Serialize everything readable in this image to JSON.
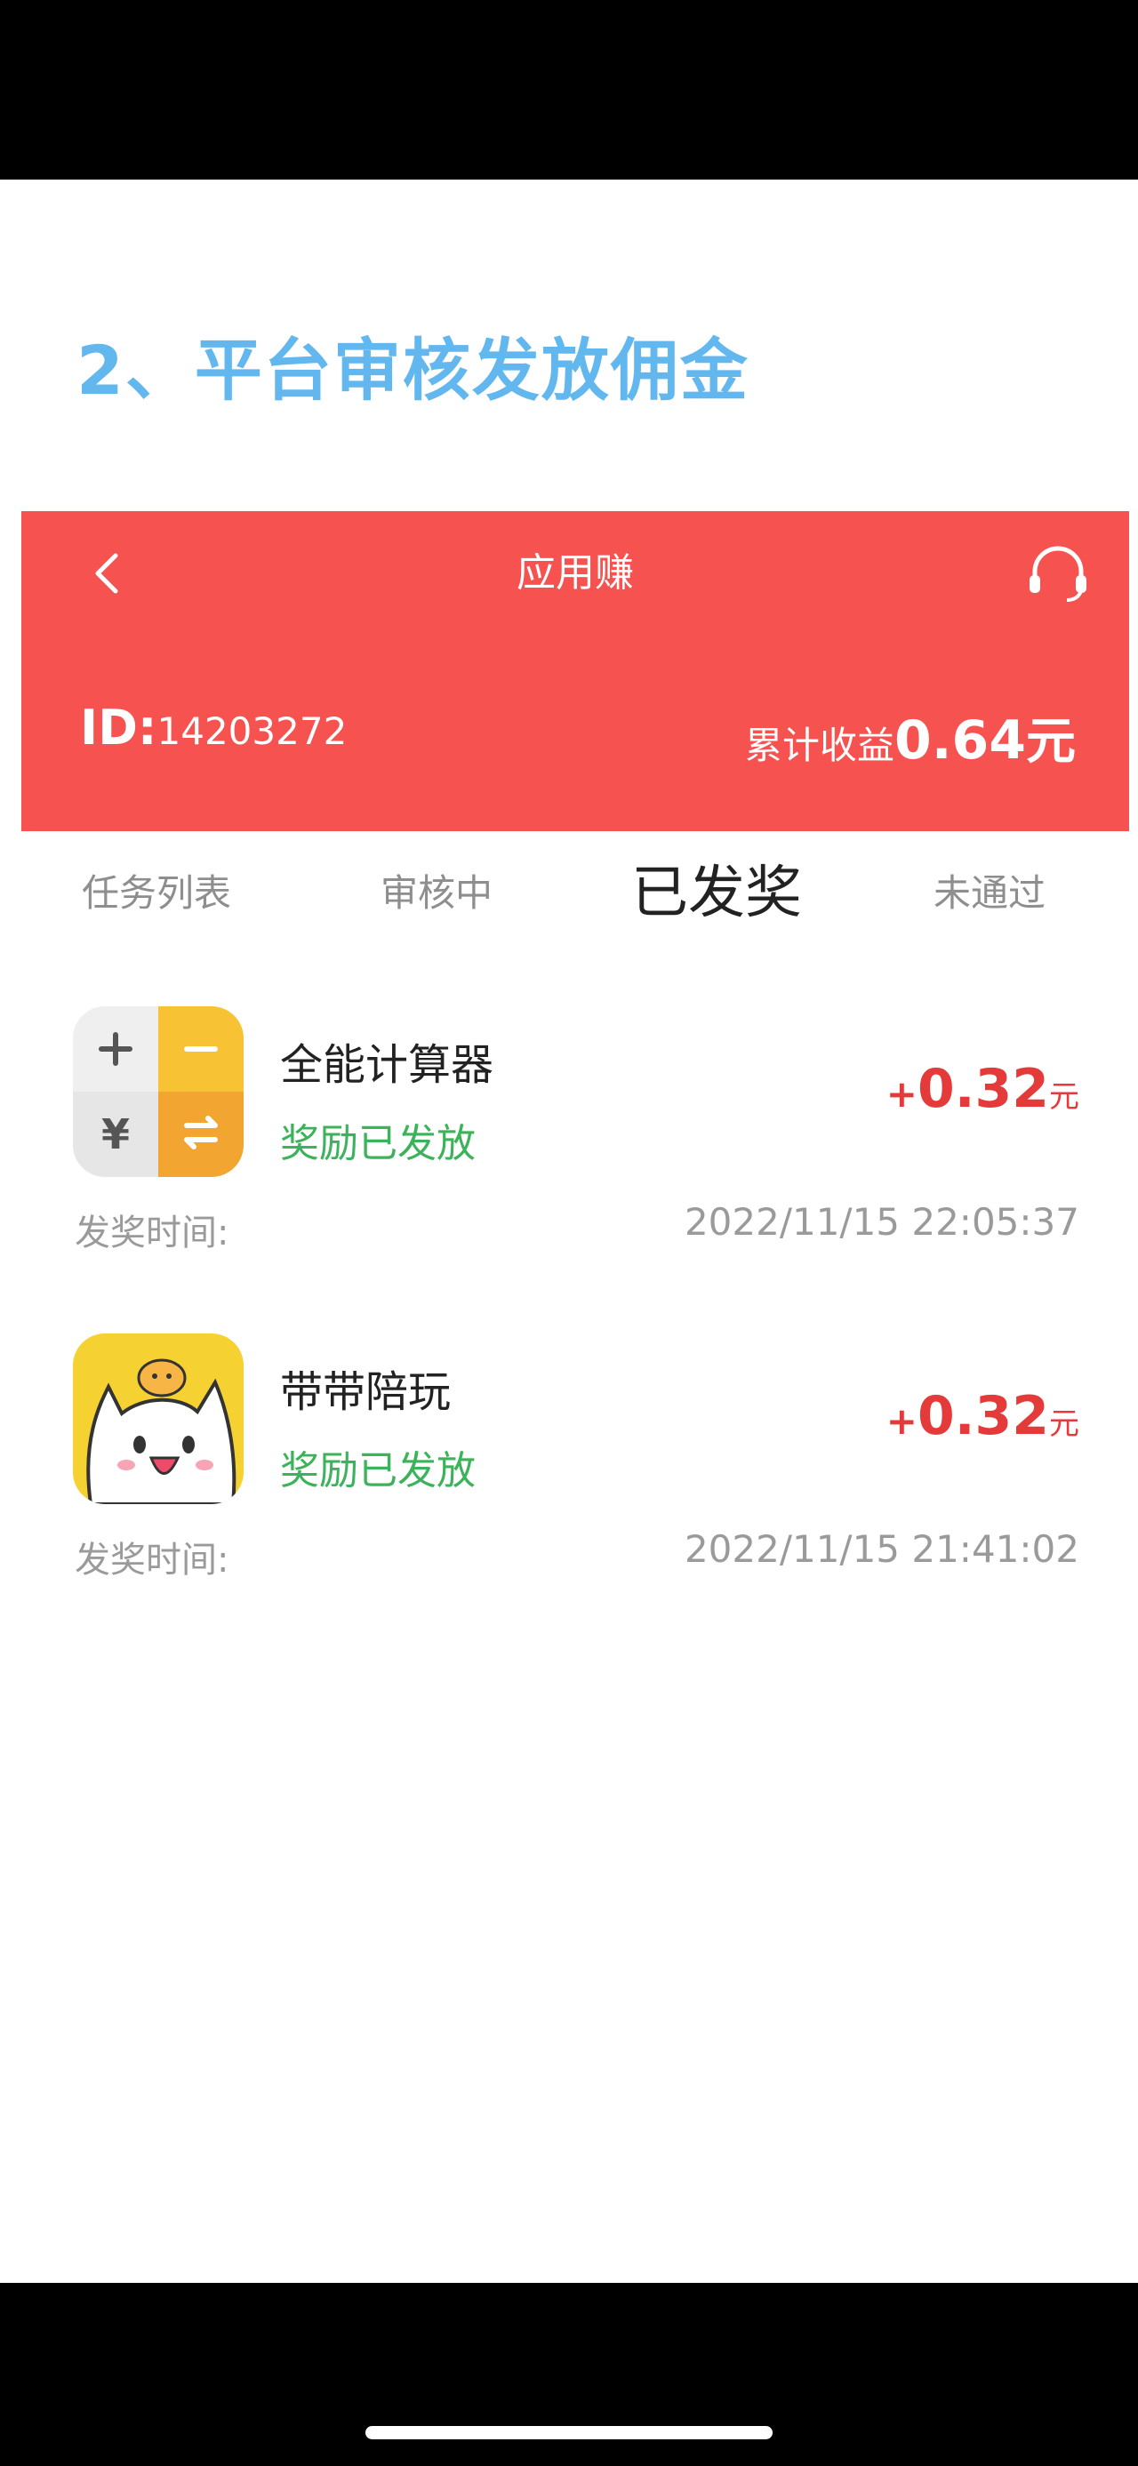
{
  "step_title": "2、平台审核发放佣金",
  "header": {
    "title": "应用赚",
    "back_icon": "chevron-left-icon",
    "support_icon": "headset-icon",
    "background": "#f55250"
  },
  "account": {
    "id_label": "ID:",
    "id_value": "14203272",
    "earnings_label": "累计收益",
    "earnings_value": "0.64",
    "earnings_unit": "元"
  },
  "tabs": [
    {
      "label": "任务列表",
      "active": false
    },
    {
      "label": "审核中",
      "active": false
    },
    {
      "label": "已发奖",
      "active": true
    },
    {
      "label": "未通过",
      "active": false
    }
  ],
  "rewards": [
    {
      "app_name": "全能计算器",
      "icon": "calculator-app-icon",
      "status": "奖励已发放",
      "amount_sign": "+",
      "amount_value": "0.32",
      "amount_unit": "元",
      "time_label": "发奖时间:",
      "time_value": "2022/11/15 22:05:37"
    },
    {
      "app_name": "带带陪玩",
      "icon": "cat-mascot-app-icon",
      "status": "奖励已发放",
      "amount_sign": "+",
      "amount_value": "0.32",
      "amount_unit": "元",
      "time_label": "发奖时间:",
      "time_value": "2022/11/15 21:41:02"
    }
  ],
  "colors": {
    "title_blue": "#62b7ee",
    "status_green": "#3cb35a",
    "amount_red": "#e43a3a"
  }
}
